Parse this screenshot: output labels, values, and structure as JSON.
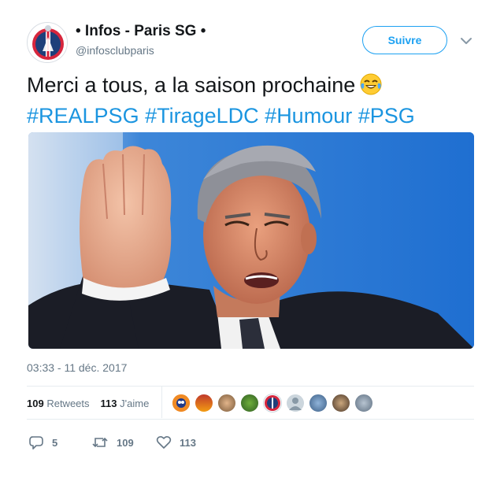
{
  "author": {
    "name": "• Infos - Paris SG •",
    "handle": "@infosclubparis",
    "avatar_icon": "psg-crest-avatar"
  },
  "follow_label": "Suivre",
  "tweet": {
    "text": "Merci a tous, a la saison prochaine",
    "emoji_icon": "face-with-tears-of-joy-emoji",
    "hashtags": [
      "#REALPSG",
      "#TirageLDC",
      "#Humour",
      "#PSG"
    ]
  },
  "timestamp": "03:33 - 11 déc. 2017",
  "stats": {
    "retweets_count": "109",
    "retweets_label": "Retweets",
    "likes_count": "113",
    "likes_label": "J'aime"
  },
  "actions": {
    "reply_count": "5",
    "retweet_count": "109",
    "like_count": "113"
  },
  "colors": {
    "accent": "#1da1f2",
    "hashtag": "#1b95e0",
    "muted": "#657786"
  }
}
